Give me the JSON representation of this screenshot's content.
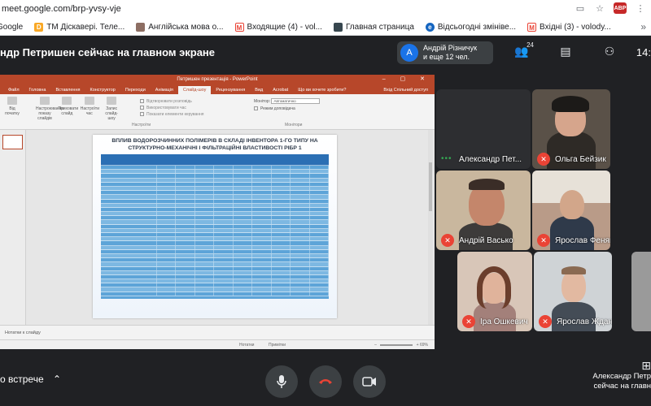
{
  "browser": {
    "url": "meet.google.com/brp-yvsy-vje",
    "bookmarks": [
      {
        "label": "Google",
        "icon": "google-icon",
        "color": "#4285f4"
      },
      {
        "label": "TM Діскавері. Теле...",
        "icon": "bookmark-d-icon",
        "color": "#f9a825"
      },
      {
        "label": "Англійська мова о...",
        "icon": "bookmark-image-icon",
        "color": "#8d6e63"
      },
      {
        "label": "Входящие (4) - vol...",
        "icon": "gmail-icon",
        "color": "#ea4335"
      },
      {
        "label": "Главная страница",
        "icon": "bookmark-page-icon",
        "color": "#37474f"
      },
      {
        "label": "Відсьогодні змініве...",
        "icon": "bookmark-e-icon",
        "color": "#1565c0"
      },
      {
        "label": "Вхідні (3) - volody...",
        "icon": "gmail-icon",
        "color": "#ea4335"
      }
    ]
  },
  "meet": {
    "presenting_title": "ндр Петришен сейчас на главном экране",
    "participants_card": {
      "avatar_letter": "A",
      "line1": "Андрій Різничук",
      "line2": "и еще 12 чел."
    },
    "people_count": "24",
    "clock": "14:",
    "meeting_details_label": "о встрече",
    "presenter": {
      "line1": "Александр Петр",
      "line2": "сейчас на главн"
    }
  },
  "powerpoint": {
    "window_title": "Петришен презентація - PowerPoint",
    "tabs": [
      "Файл",
      "Головна",
      "Вставлення",
      "Конструктор",
      "Переходи",
      "Анімація",
      "Слайд-шоу",
      "Рецензування",
      "Вид",
      "Acrobat",
      "Що ви хочете зробити?"
    ],
    "active_tab": "Слайд-шоу",
    "tab_right": "Вхід   Спільний доступ",
    "ribbon": {
      "btn_from_start": "Від початку",
      "btn_setup": "Настроювання показу слайдів",
      "btn_hide": "Приховати слайд",
      "btn_rehearse": "Настроїти час",
      "btn_record": "Запис слайд-шоу",
      "group_setup": "Настроїти",
      "check1": "Відтворювати розповідь",
      "check2": "Використовувати час",
      "check3": "Показати елементи керування",
      "monitor_label": "Монітор:",
      "monitor_value": "Автоматично",
      "presenter_view": "Режим доповідача",
      "group_monitors": "Монітори"
    },
    "slide_heading": "ВПЛИВ ВОДОРОЗЧИННИХ ПОЛІМЕРІВ В СКЛАДІ ІНВЕНТОРА 1-ГО ТИПУ НА СТРУКТУРНО-МЕХАНІЧНІ І ФІЛЬТРАЦІЙНІ ВЛАСТИВОСТІ РІБР 1",
    "notes_label": "Нотатки к слайду",
    "status_notes": "Нотатки",
    "status_comments": "Примітки",
    "zoom": "69%"
  },
  "participants": [
    {
      "name": "Александр Пет...",
      "muted": false,
      "speaking": true
    },
    {
      "name": "Ольга Бейзик",
      "muted": true
    },
    {
      "name": "Андрій Васько",
      "muted": true
    },
    {
      "name": "Ярослав Феняк",
      "muted": true
    },
    {
      "name": "Іра Ошкевич",
      "muted": true
    },
    {
      "name": "Ярослав Жданов",
      "muted": true
    }
  ],
  "colors": {
    "accent": "#1a73e8",
    "mute_red": "#ea4335",
    "ppt_brand": "#b7472a",
    "meet_bg": "#202124"
  }
}
